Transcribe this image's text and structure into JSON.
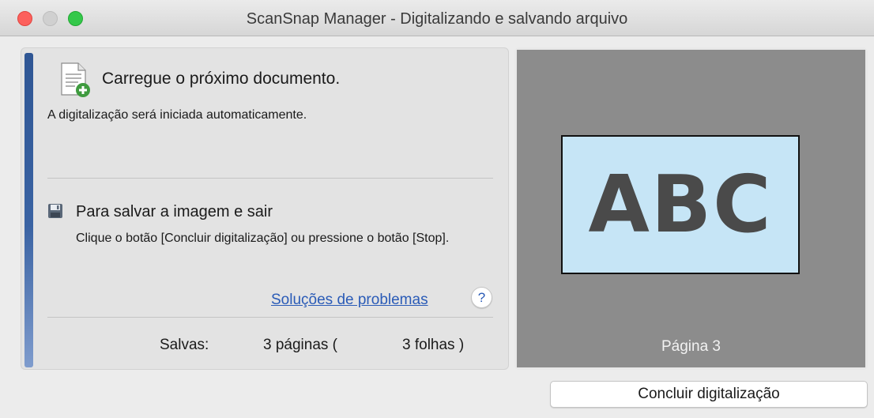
{
  "window": {
    "title": "ScanSnap Manager - Digitalizando e salvando arquivo"
  },
  "status": {
    "heading": "Carregue o próximo documento.",
    "subtext": "A digitalização será iniciada automaticamente."
  },
  "save_section": {
    "heading": "Para salvar a imagem e sair",
    "instruction": "Clique o botão [Concluir digitalização] ou pressione o botão [Stop]."
  },
  "help": {
    "link_label": "Soluções de problemas",
    "button_label": "?"
  },
  "summary": {
    "saved_label": "Salvas:",
    "pages": "3 páginas (",
    "sheets": "3 folhas )"
  },
  "preview": {
    "page_text": "ABC",
    "page_label": "Página 3",
    "page_bg": "#c6e5f6",
    "panel_bg": "#8c8c8c"
  },
  "buttons": {
    "finish": "Concluir digitalização"
  },
  "colors": {
    "accent": "#2f5694",
    "link": "#2a5bb7",
    "close": "#fc605c",
    "zoom": "#34c84a"
  },
  "icons": {
    "document": "document-add-icon",
    "save": "floppy-disk-icon",
    "help": "help-icon"
  }
}
